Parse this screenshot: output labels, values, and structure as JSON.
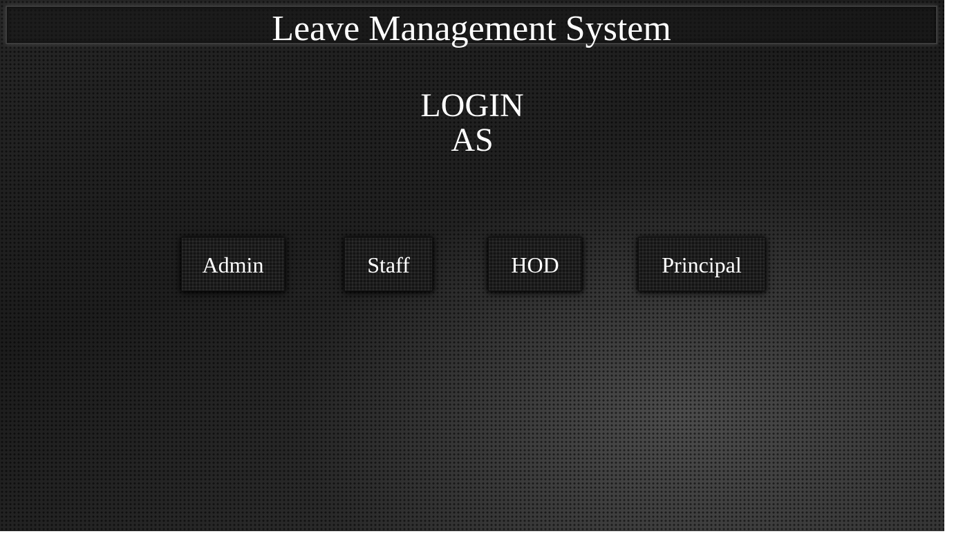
{
  "header": {
    "title": "Leave Management System"
  },
  "login": {
    "heading_line1": "LOGIN",
    "heading_line2": "AS"
  },
  "roles": [
    {
      "label": "Admin"
    },
    {
      "label": "Staff"
    },
    {
      "label": "HOD"
    },
    {
      "label": "Principal"
    }
  ],
  "colors": {
    "background": "#1f1f1f",
    "text": "#ffffff",
    "button_bg": "#141414"
  }
}
